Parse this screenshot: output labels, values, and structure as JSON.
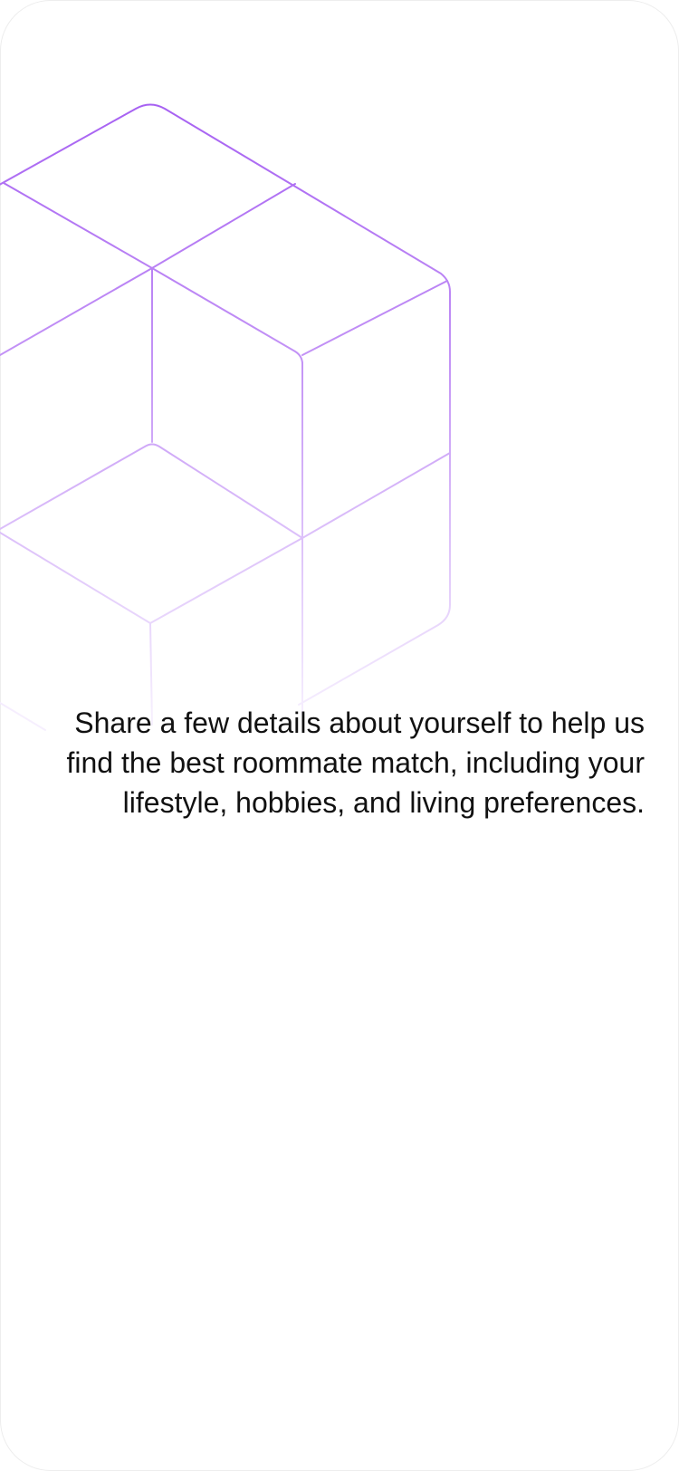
{
  "screen": {
    "description": "Share a few details about yourself to help us find the best roommate match, including your lifestyle, hobbies, and living preferences."
  },
  "illustration": {
    "icon": "isometric-cubes-icon",
    "stroke_color_top": "#a86af2",
    "stroke_color_bottom": "#f1e7fd"
  }
}
